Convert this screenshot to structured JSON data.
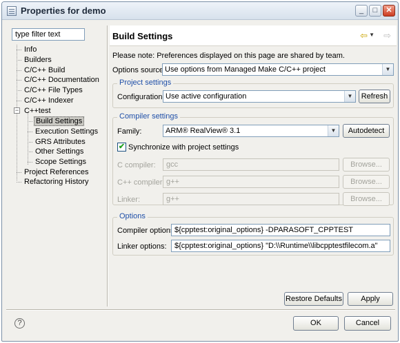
{
  "window": {
    "title": "Properties for demo",
    "minimize_glyph": "_",
    "maximize_glyph": "□",
    "close_glyph": "✕"
  },
  "sidebar": {
    "filter_value": "type filter text",
    "items": [
      {
        "label": "Info"
      },
      {
        "label": "Builders"
      },
      {
        "label": "C/C++ Build"
      },
      {
        "label": "C/C++ Documentation"
      },
      {
        "label": "C/C++ File Types"
      },
      {
        "label": "C/C++ Indexer"
      },
      {
        "label": "C++test",
        "expanded": true
      },
      {
        "label": "Build Settings",
        "selected": true
      },
      {
        "label": "Execution Settings"
      },
      {
        "label": "GRS Attributes"
      },
      {
        "label": "Other Settings"
      },
      {
        "label": "Scope Settings"
      },
      {
        "label": "Project References"
      },
      {
        "label": "Refactoring History"
      }
    ],
    "expander_glyph": "−"
  },
  "page": {
    "title": "Build Settings",
    "note": "Please note: Preferences displayed on this page are shared by team.",
    "options_source_label": "Options source:",
    "options_source_value": "Use options from Managed Make C/C++ project",
    "project_settings": {
      "title": "Project settings",
      "configuration_label": "Configuration:",
      "configuration_value": "Use active configuration",
      "refresh_label": "Refresh"
    },
    "compiler_settings": {
      "title": "Compiler settings",
      "family_label": "Family:",
      "family_value": "ARM® RealView® 3.1",
      "autodetect_label": "Autodetect",
      "sync_label": "Synchronize with project settings",
      "sync_checked": true,
      "c_compiler_label": "C compiler:",
      "c_compiler_value": "gcc",
      "cpp_compiler_label": "C++ compiler:",
      "cpp_compiler_value": "g++",
      "linker_label": "Linker:",
      "linker_value": "g++",
      "browse_label": "Browse..."
    },
    "options": {
      "title": "Options",
      "compiler_options_label": "Compiler options:",
      "compiler_options_value": "${cpptest:original_options} -DPARASOFT_CPPTEST",
      "linker_options_label": "Linker options:",
      "linker_options_value": "${cpptest:original_options} \"D:\\\\Runtime\\\\libcpptestfilecom.a\""
    },
    "restore_defaults_label": "Restore Defaults",
    "apply_label": "Apply"
  },
  "footer": {
    "help_glyph": "?",
    "ok_label": "OK",
    "cancel_label": "Cancel"
  },
  "colors": {
    "group_title": "#1f4fa8",
    "dialog_bg": "#f1f0ec",
    "disabled_text": "#a3a39c"
  }
}
